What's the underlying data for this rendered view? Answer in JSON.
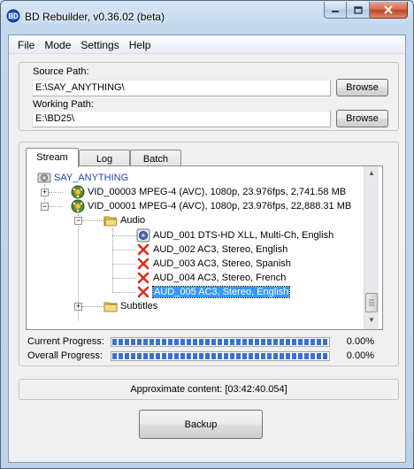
{
  "window": {
    "title": "BD Rebuilder, v0.36.02 (beta)"
  },
  "menu": [
    "File",
    "Mode",
    "Settings",
    "Help"
  ],
  "source": {
    "label": "Source Path:",
    "value": "E:\\SAY_ANYTHING\\",
    "browse": "Browse"
  },
  "working": {
    "label": "Working Path:",
    "value": "E:\\BD25\\",
    "browse": "Browse"
  },
  "tabs": [
    "Stream",
    "Log",
    "Batch"
  ],
  "tree": {
    "root": "SAY_ANYTHING",
    "videos": [
      "VID_00003 MPEG-4 (AVC), 1080p, 23.976fps, 2,741.58 MB",
      "VID_00001 MPEG-4 (AVC), 1080p, 23.976fps, 22,888.31 MB"
    ],
    "audio_folder": "Audio",
    "audio": [
      {
        "label": "AUD_001 DTS-HD XLL, Multi-Ch, English",
        "status": "speaker-icon"
      },
      {
        "label": "AUD_002 AC3, Stereo, English",
        "status": "x-icon"
      },
      {
        "label": "AUD_003 AC3, Stereo, Spanish",
        "status": "x-icon"
      },
      {
        "label": "AUD_004 AC3, Stereo, French",
        "status": "x-icon"
      },
      {
        "label": "AUD_005 AC3, Stereo, English",
        "status": "x-icon",
        "selected": true
      }
    ],
    "subtitles_folder": "Subtitles"
  },
  "progress": {
    "current": {
      "label": "Current Progress:",
      "value": 1.0,
      "text": "0.00%"
    },
    "overall": {
      "label": "Overall Progress:",
      "value": 1.0,
      "text": "0.00%"
    }
  },
  "status": "Approximate content: [03:42:40.054]",
  "backup_button": "Backup",
  "colors": {
    "selection": "#3399ff",
    "progress": "#3a6fd8",
    "x_mark": "#e0281c"
  }
}
